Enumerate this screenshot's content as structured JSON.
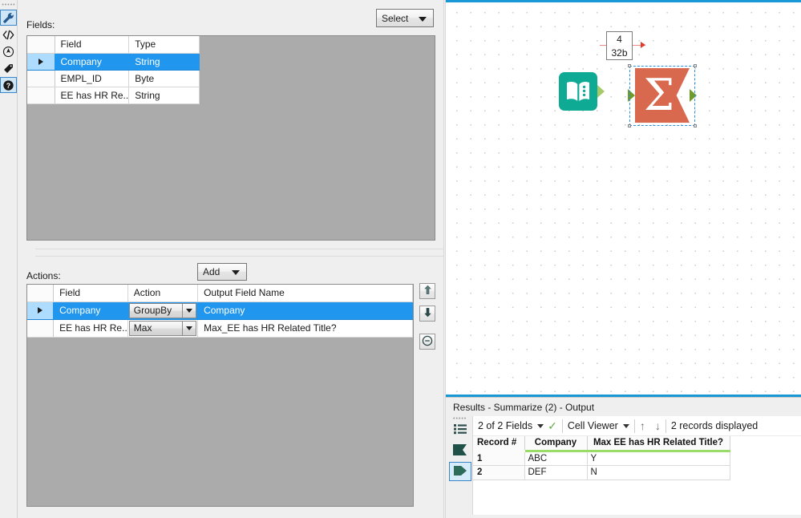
{
  "icon_rail": {
    "items": [
      {
        "name": "wrench-icon",
        "label": "Configuration",
        "selected": true
      },
      {
        "name": "code-icon",
        "label": "XML View",
        "selected": false
      },
      {
        "name": "compass-icon",
        "label": "Annotation",
        "selected": false
      },
      {
        "name": "tag-icon",
        "label": "Label",
        "selected": false
      },
      {
        "name": "help-icon",
        "label": "Help",
        "selected": true
      }
    ]
  },
  "config": {
    "fields_label": "Fields:",
    "select_combo": "Select",
    "actions_label": "Actions:",
    "add_combo": "Add",
    "fields_table": {
      "columns": [
        "",
        "Field",
        "Type"
      ],
      "rows": [
        {
          "selected": true,
          "field": "Company",
          "type": "String"
        },
        {
          "selected": false,
          "field": "EMPL_ID",
          "type": "Byte"
        },
        {
          "selected": false,
          "field": "EE has HR Re..",
          "type": "String"
        }
      ]
    },
    "actions_table": {
      "columns": [
        "",
        "Field",
        "Action",
        "Output Field Name"
      ],
      "rows": [
        {
          "selected": true,
          "field": "Company",
          "action": "GroupBy",
          "output": "Company"
        },
        {
          "selected": false,
          "field": "EE has HR Re..",
          "action": "Max",
          "output": "Max_EE has HR Related Title?"
        }
      ]
    },
    "side_buttons": [
      {
        "name": "move-up-button",
        "glyph": "↑"
      },
      {
        "name": "move-down-button",
        "glyph": "↓"
      },
      {
        "name": "remove-button",
        "glyph": "⊖"
      }
    ]
  },
  "canvas": {
    "nodes": [
      {
        "name": "input-data-node",
        "type": "input-data",
        "icon": "book-icon",
        "color": "#0faa94"
      },
      {
        "name": "summarize-node",
        "type": "summarize",
        "icon": "sigma-icon",
        "color": "#d9694e",
        "selected": true
      }
    ],
    "connection_label": {
      "records": "4",
      "size": "32b"
    }
  },
  "results": {
    "title": "Results - Summarize (2) - Output",
    "rail_icons": [
      {
        "name": "list-view-icon",
        "selected": false
      },
      {
        "name": "flag-icon",
        "selected": false
      },
      {
        "name": "output-anchor-icon",
        "selected": true
      }
    ],
    "toolbar": {
      "fields_selector": "2 of 2 Fields",
      "check_icon": "✓",
      "viewer_selector": "Cell Viewer",
      "up_arrow": "↑",
      "down_arrow": "↓",
      "record_count": "2 records displayed"
    },
    "table": {
      "columns": [
        "Record #",
        "Company",
        "Max EE has HR Related Title?"
      ],
      "rows": [
        {
          "record": "1",
          "company": "ABC",
          "max_flag": "Y"
        },
        {
          "record": "2",
          "company": "DEF",
          "max_flag": "N"
        }
      ]
    }
  },
  "colors": {
    "accent_blue": "#1899d6",
    "selection_blue": "#2196ee",
    "input_teal": "#0faa94",
    "summarize_orange": "#d9694e",
    "string_underline_green": "#9adb6a",
    "panel_gray": "#ababab"
  }
}
